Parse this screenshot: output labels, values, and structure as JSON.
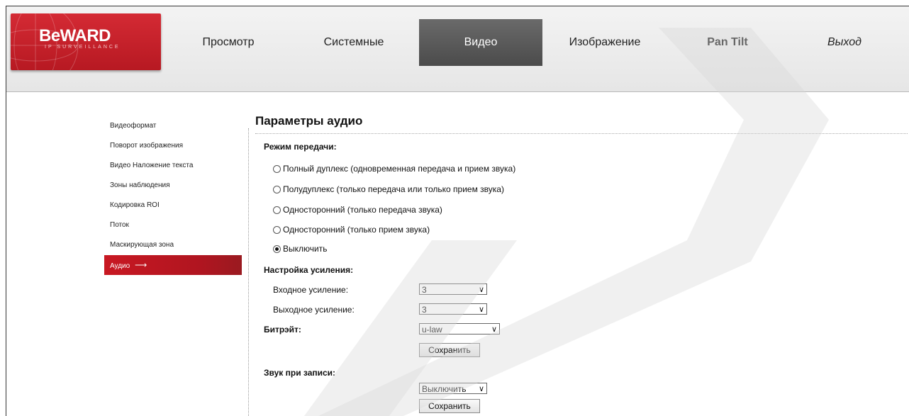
{
  "logo": {
    "brand": "BeWARD",
    "tagline": "IP SURVEILLANCE"
  },
  "nav": {
    "items": [
      {
        "label": "Просмотр"
      },
      {
        "label": "Системные"
      },
      {
        "label": "Видео"
      },
      {
        "label": "Изображение"
      },
      {
        "label": "Pan Tilt"
      },
      {
        "label": "Выход"
      }
    ],
    "active": "Видео"
  },
  "sidebar": {
    "items": [
      {
        "label": "Видеоформат"
      },
      {
        "label": "Поворот изображения"
      },
      {
        "label": "Видео Наложение текста"
      },
      {
        "label": "Зоны наблюдения"
      },
      {
        "label": "Кодировка ROI"
      },
      {
        "label": "Поток"
      },
      {
        "label": "Маскирующая зона"
      },
      {
        "label": "Аудио"
      }
    ],
    "active": "Аудио",
    "active_icon": "arrow-right-icon"
  },
  "page": {
    "title": "Параметры аудио"
  },
  "mode": {
    "heading": "Режим передачи:",
    "options": [
      {
        "label": "Полный дуплекс (одновременная передача и прием звука)"
      },
      {
        "label": "Полудуплекс (только передача или только прием звука)"
      },
      {
        "label": "Односторонний (только передача звука)"
      },
      {
        "label": "Односторонний (только прием звука)"
      },
      {
        "label": "Выключить"
      }
    ],
    "selected": "Выключить"
  },
  "gain": {
    "heading": "Настройка усиления:",
    "input_label": "Входное усиление:",
    "input_value": "3",
    "output_label": "Выходное усиление:",
    "output_value": "3"
  },
  "bitrate": {
    "label": "Битрэйт:",
    "value": "u-law",
    "save": "Сохранить"
  },
  "record": {
    "label": "Звук при записи:",
    "value": "Выключить",
    "save": "Сохранить"
  },
  "colors": {
    "brand_red": "#c81822",
    "active_tab": "#555555"
  }
}
